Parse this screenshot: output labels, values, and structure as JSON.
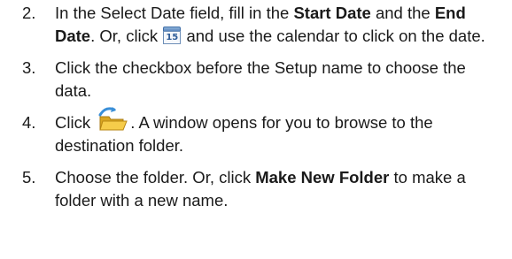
{
  "steps": [
    {
      "number": "2.",
      "before_cal": "In the Select Date field, fill in the ",
      "bold_start": "Start Date",
      "and_text": " and the ",
      "bold_end": "End Date",
      "or_click": ". Or, click ",
      "calendar_icon_text": "15",
      "after_cal": " and use the calendar to click on the date."
    },
    {
      "number": "3.",
      "text": "Click the checkbox before the Setup name to choose the data."
    },
    {
      "number": "4.",
      "before_icon": "Click ",
      "folder_icon": "open-folder-icon",
      "after_icon": ". A window opens for you to browse to the destination folder."
    },
    {
      "number": "5.",
      "before_bold": "Choose the folder. Or, click ",
      "bold": "Make New Folder",
      "after_bold": " to make a folder with a new name."
    }
  ]
}
